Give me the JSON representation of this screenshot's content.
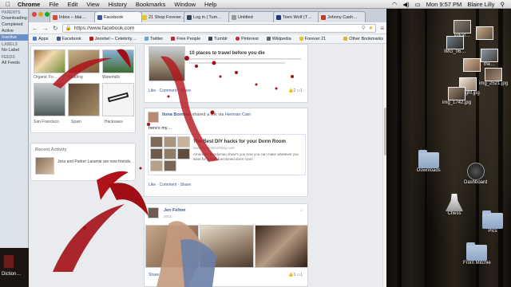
{
  "menubar": {
    "apple": "",
    "app": "Chrome",
    "items": [
      "File",
      "Edit",
      "View",
      "History",
      "Bookmarks",
      "Window",
      "Help"
    ],
    "clock": "Mon 9:57 PM",
    "user": "Blaire Lilly"
  },
  "browser": {
    "tabs": [
      {
        "title": "Inbox – blai…",
        "color": "#d64a3a"
      },
      {
        "title": "Facebook",
        "color": "#3b5998"
      },
      {
        "title": "21 Shop Forever…",
        "color": "#e8c51f"
      },
      {
        "title": "Log in | Tum…",
        "color": "#35465c"
      },
      {
        "title": "Untitled",
        "color": "#999999"
      },
      {
        "title": "Teen Wolf (T…",
        "color": "#1b3b7a"
      },
      {
        "title": "Johnny Cash…",
        "color": "#c23b1e"
      }
    ],
    "url": "https://www.facebook.com",
    "bookmarks": [
      {
        "label": "Apps",
        "color": "#4a7bd0"
      },
      {
        "label": "Facebook",
        "color": "#3b5998"
      },
      {
        "label": "Jezebel – Celebrity…",
        "color": "#b22222"
      },
      {
        "label": "Twitter",
        "color": "#55acee"
      },
      {
        "label": "Free People",
        "color": "#a33"
      },
      {
        "label": "Tumblr",
        "color": "#35465c"
      },
      {
        "label": "Pinterest",
        "color": "#cb2027"
      },
      {
        "label": "Wikipedia",
        "color": "#666666"
      },
      {
        "label": "Forever 21",
        "color": "#e8c51f"
      }
    ],
    "other_bookmarks": "Other Bookmarks"
  },
  "facebook": {
    "photos": {
      "captions": [
        "Organic Fo…",
        "Reading",
        "Waterfalls",
        "San Francisco",
        "Spain",
        "Hacksaws"
      ]
    },
    "recent_activity": {
      "heading": "Recent Activity",
      "item_text": "Jess and Parker Laramie are now friends."
    },
    "post1": {
      "title": "10 places to travel before you die",
      "like": "Like",
      "comment": "Comment",
      "share": "Share",
      "likes": "2",
      "comments": "1"
    },
    "post2": {
      "author": "Ilona Bommel",
      "action": "shared a link via",
      "via": "Herman Cain",
      "text": "here's my…",
      "link_title": "The Best DIY hacks for your Dorm Room",
      "link_domain": "www.bestlisteverblog.com",
      "link_desc": "America's handyman show's you how you can make whatever you want for a high-functioned dorm room",
      "like": "Like",
      "comment": "Comment",
      "share": "Share"
    },
    "post3": {
      "author": "Jen Felton",
      "date": "2013",
      "share": "Share",
      "likes": "3",
      "comments": "1"
    }
  },
  "finder": {
    "sections": [
      "PARENTS",
      "Downloading",
      "Completed",
      "Active",
      "Inactive",
      "LABELS",
      "No Label",
      "FEEDS",
      "All Feeds"
    ],
    "bottom_label": "Diction…"
  },
  "desktop": {
    "files": [
      "kitkat…",
      "IMG_06…",
      "the…",
      "img_2521.jpg",
      "…night.jpg",
      "img_1742.jpg"
    ],
    "icons": [
      "Downloads",
      "Dashboard",
      "Chess",
      "Pics",
      "From Mitchie"
    ]
  }
}
